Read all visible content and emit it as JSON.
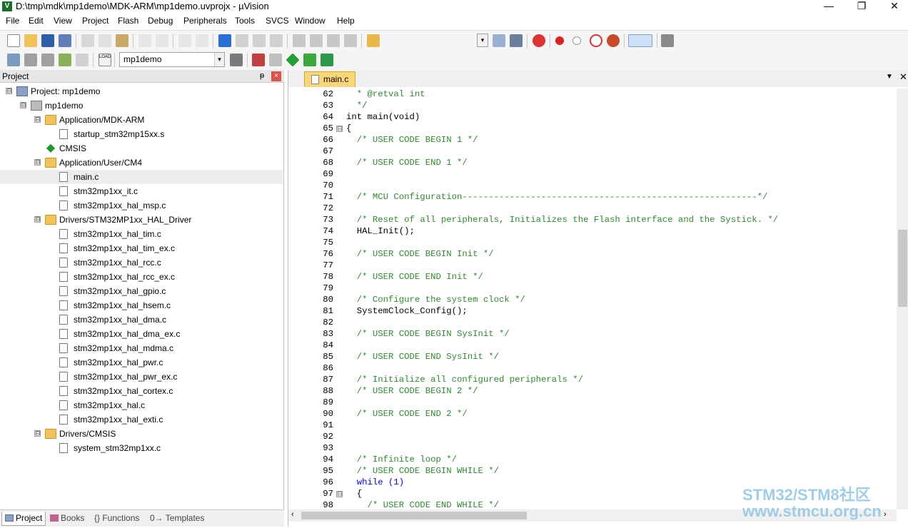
{
  "window": {
    "title": "D:\\tmp\\mdk\\mp1demo\\MDK-ARM\\mp1demo.uvprojx - µVision",
    "minimize": "—",
    "maximize": "❐",
    "close": "✕"
  },
  "menu": [
    "File",
    "Edit",
    "View",
    "Project",
    "Flash",
    "Debug",
    "Peripherals",
    "Tools",
    "SVCS",
    "Window",
    "Help"
  ],
  "toolbar": {
    "target_value": "mp1demo",
    "load_label": "LOAD"
  },
  "project_panel": {
    "title": "Project",
    "pin": "ᵽ",
    "close": "×",
    "tree": [
      {
        "label": "Project: mp1demo",
        "level": 0,
        "icon": "project-icon",
        "expander": "⊟"
      },
      {
        "label": "mp1demo",
        "level": 1,
        "icon": "target-icon",
        "expander": "⊟"
      },
      {
        "label": "Application/MDK-ARM",
        "level": 2,
        "icon": "folder-icon",
        "expander": "⊟"
      },
      {
        "label": "startup_stm32mp15xx.s",
        "level": 3,
        "icon": "file-icon"
      },
      {
        "label": "CMSIS",
        "level": 2,
        "icon": "cmsis-icon"
      },
      {
        "label": "Application/User/CM4",
        "level": 2,
        "icon": "folder-icon",
        "expander": "⊟"
      },
      {
        "label": "main.c",
        "level": 3,
        "icon": "file-icon",
        "selected": true
      },
      {
        "label": "stm32mp1xx_it.c",
        "level": 3,
        "icon": "file-icon"
      },
      {
        "label": "stm32mp1xx_hal_msp.c",
        "level": 3,
        "icon": "file-icon"
      },
      {
        "label": "Drivers/STM32MP1xx_HAL_Driver",
        "level": 2,
        "icon": "folder-icon",
        "expander": "⊟"
      },
      {
        "label": "stm32mp1xx_hal_tim.c",
        "level": 3,
        "icon": "file-icon"
      },
      {
        "label": "stm32mp1xx_hal_tim_ex.c",
        "level": 3,
        "icon": "file-icon"
      },
      {
        "label": "stm32mp1xx_hal_rcc.c",
        "level": 3,
        "icon": "file-icon"
      },
      {
        "label": "stm32mp1xx_hal_rcc_ex.c",
        "level": 3,
        "icon": "file-icon"
      },
      {
        "label": "stm32mp1xx_hal_gpio.c",
        "level": 3,
        "icon": "file-icon"
      },
      {
        "label": "stm32mp1xx_hal_hsem.c",
        "level": 3,
        "icon": "file-icon"
      },
      {
        "label": "stm32mp1xx_hal_dma.c",
        "level": 3,
        "icon": "file-icon"
      },
      {
        "label": "stm32mp1xx_hal_dma_ex.c",
        "level": 3,
        "icon": "file-icon"
      },
      {
        "label": "stm32mp1xx_hal_mdma.c",
        "level": 3,
        "icon": "file-icon"
      },
      {
        "label": "stm32mp1xx_hal_pwr.c",
        "level": 3,
        "icon": "file-icon"
      },
      {
        "label": "stm32mp1xx_hal_pwr_ex.c",
        "level": 3,
        "icon": "file-icon"
      },
      {
        "label": "stm32mp1xx_hal_cortex.c",
        "level": 3,
        "icon": "file-icon"
      },
      {
        "label": "stm32mp1xx_hal.c",
        "level": 3,
        "icon": "file-icon"
      },
      {
        "label": "stm32mp1xx_hal_exti.c",
        "level": 3,
        "icon": "file-icon"
      },
      {
        "label": "Drivers/CMSIS",
        "level": 2,
        "icon": "folder-icon",
        "expander": "⊟"
      },
      {
        "label": "system_stm32mp1xx.c",
        "level": 3,
        "icon": "file-icon"
      }
    ],
    "tabs": [
      "Project",
      "Books",
      "{} Functions",
      "0→ Templates"
    ]
  },
  "editor": {
    "active_tab": "main.c",
    "tab_dropdown": "▼",
    "tab_close": "✕",
    "lines": [
      {
        "n": "62",
        "text": "  * @retval int",
        "kind": "comment"
      },
      {
        "n": "63",
        "text": "  */",
        "kind": "comment"
      },
      {
        "n": "64",
        "text": "int main(void)",
        "kind": "code"
      },
      {
        "n": "65",
        "text": "{",
        "kind": "code",
        "fold": "⊟"
      },
      {
        "n": "66",
        "text": "  /* USER CODE BEGIN 1 */",
        "kind": "comment"
      },
      {
        "n": "67",
        "text": "",
        "kind": "code"
      },
      {
        "n": "68",
        "text": "  /* USER CODE END 1 */",
        "kind": "comment"
      },
      {
        "n": "69",
        "text": "",
        "kind": "code"
      },
      {
        "n": "70",
        "text": "",
        "kind": "code"
      },
      {
        "n": "71",
        "text": "  /* MCU Configuration--------------------------------------------------------*/",
        "kind": "comment"
      },
      {
        "n": "72",
        "text": "",
        "kind": "code"
      },
      {
        "n": "73",
        "text": "  /* Reset of all peripherals, Initializes the Flash interface and the Systick. */",
        "kind": "comment"
      },
      {
        "n": "74",
        "text": "  HAL_Init();",
        "kind": "code"
      },
      {
        "n": "75",
        "text": "",
        "kind": "code"
      },
      {
        "n": "76",
        "text": "  /* USER CODE BEGIN Init */",
        "kind": "comment"
      },
      {
        "n": "77",
        "text": "",
        "kind": "code"
      },
      {
        "n": "78",
        "text": "  /* USER CODE END Init */",
        "kind": "comment"
      },
      {
        "n": "79",
        "text": "",
        "kind": "code"
      },
      {
        "n": "80",
        "text": "  /* Configure the system clock */",
        "kind": "comment"
      },
      {
        "n": "81",
        "text": "  SystemClock_Config();",
        "kind": "code"
      },
      {
        "n": "82",
        "text": "",
        "kind": "code"
      },
      {
        "n": "83",
        "text": "  /* USER CODE BEGIN SysInit */",
        "kind": "comment"
      },
      {
        "n": "84",
        "text": "",
        "kind": "code"
      },
      {
        "n": "85",
        "text": "  /* USER CODE END SysInit */",
        "kind": "comment"
      },
      {
        "n": "86",
        "text": "",
        "kind": "code"
      },
      {
        "n": "87",
        "text": "  /* Initialize all configured peripherals */",
        "kind": "comment"
      },
      {
        "n": "88",
        "text": "  /* USER CODE BEGIN 2 */",
        "kind": "comment"
      },
      {
        "n": "89",
        "text": "",
        "kind": "code"
      },
      {
        "n": "90",
        "text": "  /* USER CODE END 2 */",
        "kind": "comment"
      },
      {
        "n": "91",
        "text": "",
        "kind": "code"
      },
      {
        "n": "92",
        "text": "",
        "kind": "code"
      },
      {
        "n": "93",
        "text": "",
        "kind": "code"
      },
      {
        "n": "94",
        "text": "  /* Infinite loop */",
        "kind": "comment"
      },
      {
        "n": "95",
        "text": "  /* USER CODE BEGIN WHILE */",
        "kind": "comment"
      },
      {
        "n": "96",
        "text": "  while (1)",
        "kind": "keyword"
      },
      {
        "n": "97",
        "text": "  {",
        "kind": "code",
        "fold": "⊟"
      },
      {
        "n": "98",
        "text": "    /* USER CODE END WHILE */",
        "kind": "comment"
      }
    ]
  },
  "watermark": {
    "line1": "STM32/STM8社区",
    "line2": "www.stmcu.org.cn"
  }
}
